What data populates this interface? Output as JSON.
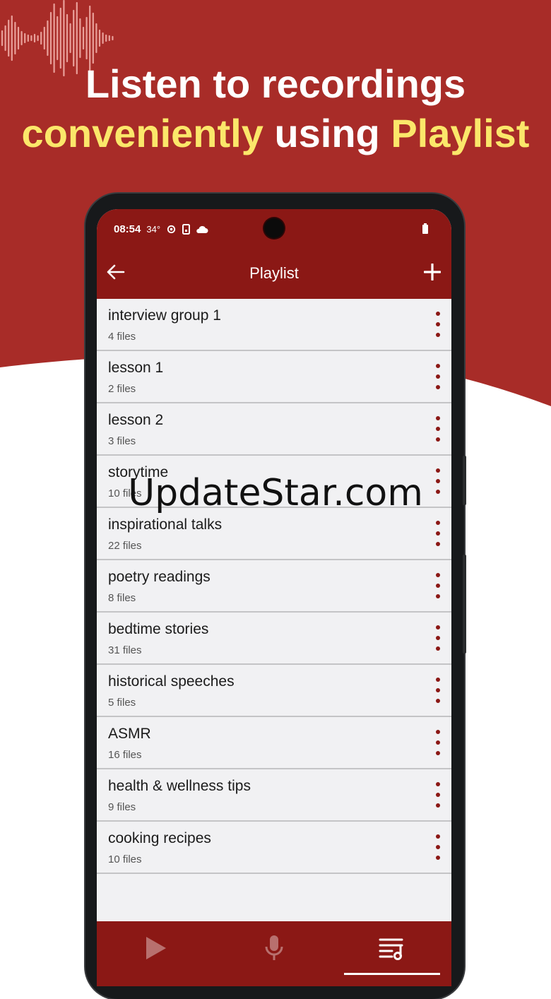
{
  "promo": {
    "line1": "Listen to recordings",
    "line2_a": "conveniently",
    "line2_b": "using",
    "line2_c": "Playlist",
    "colors": {
      "background": "#a82c28",
      "highlight": "#fbe76a"
    }
  },
  "status_bar": {
    "time": "08:54",
    "temperature": "34°",
    "icons": [
      "settings-icon",
      "phone-icon",
      "cloud-icon",
      "battery-icon"
    ]
  },
  "app_bar": {
    "title": "Playlist",
    "back_icon": "arrow-left-icon",
    "add_icon": "plus-icon"
  },
  "playlists": [
    {
      "name": "interview group 1",
      "count": "4 files"
    },
    {
      "name": "lesson 1",
      "count": "2 files"
    },
    {
      "name": "lesson 2",
      "count": "3 files"
    },
    {
      "name": "storytime",
      "count": "10 files"
    },
    {
      "name": "inspirational talks",
      "count": "22 files"
    },
    {
      "name": "poetry readings",
      "count": "8 files"
    },
    {
      "name": "bedtime stories",
      "count": "31 files"
    },
    {
      "name": "historical speeches",
      "count": "5 files"
    },
    {
      "name": "ASMR",
      "count": "16 files"
    },
    {
      "name": "health & wellness tips",
      "count": "9 files"
    },
    {
      "name": "cooking recipes",
      "count": "10 files"
    }
  ],
  "bottom_nav": {
    "tabs": [
      "play-icon",
      "microphone-icon",
      "playlist-icon"
    ],
    "active": "playlist-icon"
  },
  "watermark": "UpdateStar.com",
  "colors": {
    "app_primary": "#8b1815",
    "list_bg": "#f1f1f3"
  }
}
